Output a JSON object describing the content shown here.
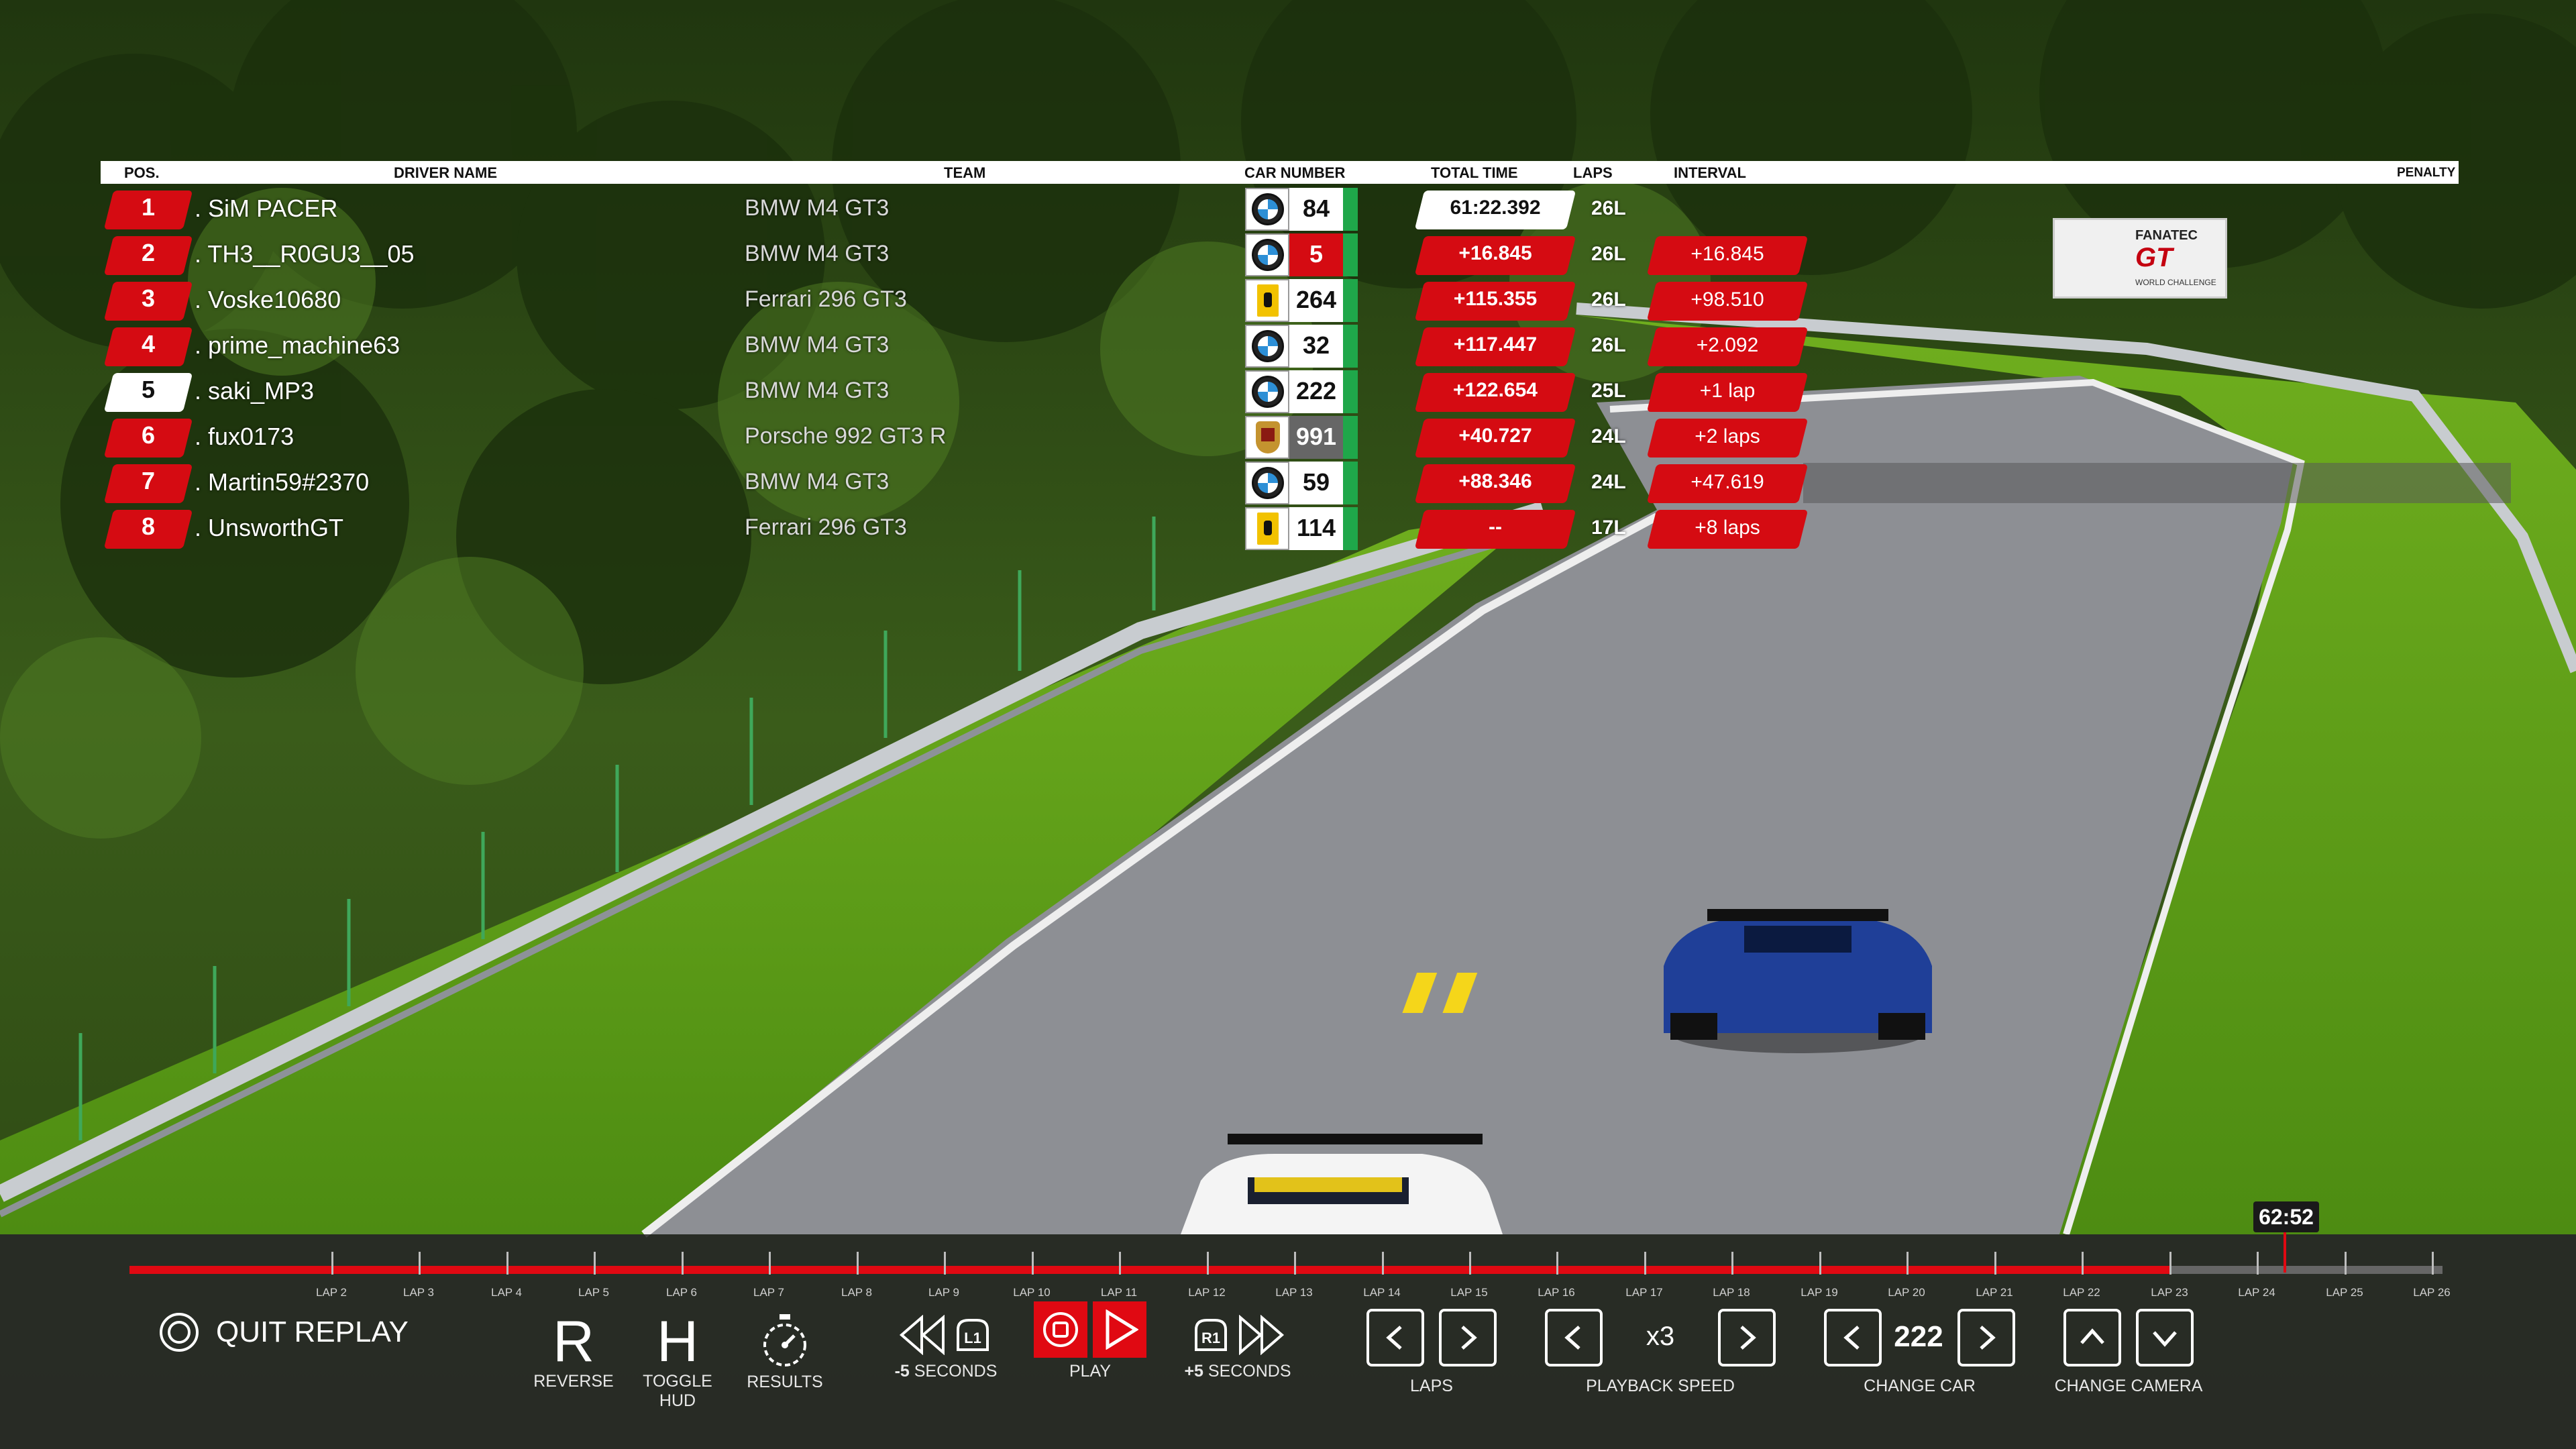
{
  "leaderboard": {
    "headers": {
      "pos": "POS.",
      "driver": "DRIVER NAME",
      "team": "TEAM",
      "car_number": "CAR NUMBER",
      "total_time": "TOTAL TIME",
      "laps": "LAPS",
      "interval": "INTERVAL",
      "penalty": "PENALTY"
    },
    "rows": [
      {
        "pos": "1",
        "driver": ". SiM PACER",
        "team": "BMW M4 GT3",
        "brand": "bmw-logo",
        "number": "84",
        "total_time": "61:22.392",
        "laps": "26L",
        "interval": ""
      },
      {
        "pos": "2",
        "driver": ". TH3__R0GU3__05",
        "team": "BMW M4 GT3",
        "brand": "bmw-logo",
        "number": "5",
        "total_time": "+16.845",
        "laps": "26L",
        "interval": "+16.845"
      },
      {
        "pos": "3",
        "driver": ". Voske10680",
        "team": "Ferrari 296 GT3",
        "brand": "ferrari-logo",
        "number": "264",
        "total_time": "+115.355",
        "laps": "26L",
        "interval": "+98.510"
      },
      {
        "pos": "4",
        "driver": ". prime_machine63",
        "team": "BMW M4 GT3",
        "brand": "bmw-logo",
        "number": "32",
        "total_time": "+117.447",
        "laps": "26L",
        "interval": "+2.092"
      },
      {
        "pos": "5",
        "driver": ". saki_MP3",
        "team": "BMW M4 GT3",
        "brand": "bmw-logo",
        "number": "222",
        "total_time": "+122.654",
        "laps": "25L",
        "interval": "+1 lap"
      },
      {
        "pos": "6",
        "driver": ". fux0173",
        "team": "Porsche 992 GT3 R",
        "brand": "porsche-logo",
        "number": "991",
        "total_time": "+40.727",
        "laps": "24L",
        "interval": "+2 laps"
      },
      {
        "pos": "7",
        "driver": ". Martin59#2370",
        "team": "BMW M4 GT3",
        "brand": "bmw-logo",
        "number": "59",
        "total_time": "+88.346",
        "laps": "24L",
        "interval": "+47.619"
      },
      {
        "pos": "8",
        "driver": ". UnsworthGT",
        "team": "Ferrari 296 GT3",
        "brand": "ferrari-logo",
        "number": "114",
        "total_time": "--",
        "laps": "17L",
        "interval": "+8 laps"
      }
    ]
  },
  "sign": {
    "line1": "FANATEC",
    "line2": "GT",
    "line3": "WORLD CHALLENGE"
  },
  "replay": {
    "current_time": "62:52",
    "progress": 0.882,
    "laps": [
      "LAP 2",
      "LAP 3",
      "LAP 4",
      "LAP 5",
      "LAP 6",
      "LAP 7",
      "LAP 8",
      "LAP 9",
      "LAP 10",
      "LAP 11",
      "LAP 12",
      "LAP 13",
      "LAP 14",
      "LAP 15",
      "LAP 16",
      "LAP 17",
      "LAP 18",
      "LAP 19",
      "LAP 20",
      "LAP 21",
      "LAP 22",
      "LAP 23",
      "LAP 24",
      "LAP 25",
      "LAP 26"
    ],
    "quit": "QUIT REPLAY",
    "reverse_key": "R",
    "reverse": "REVERSE",
    "toggle_key": "H",
    "toggle_hud_1": "TOGGLE",
    "toggle_hud_2": "HUD",
    "results": "RESULTS",
    "back_key": "L1",
    "back_value": "-5",
    "back_unit": " SECONDS",
    "play": "PLAY",
    "fwd_key": "R1",
    "fwd_value": "+5",
    "fwd_unit": " SECONDS",
    "laps_label": "LAPS",
    "speed_value": "x3",
    "speed_label": "PLAYBACK SPEED",
    "car_value": "222",
    "car_label": "CHANGE CAR",
    "camera_label": "CHANGE CAMERA"
  },
  "colors": {
    "accent_red": "#d50b12",
    "timeline_red": "#e00912",
    "bar_bg": "#282828",
    "green_strip": "#1fa74a"
  }
}
